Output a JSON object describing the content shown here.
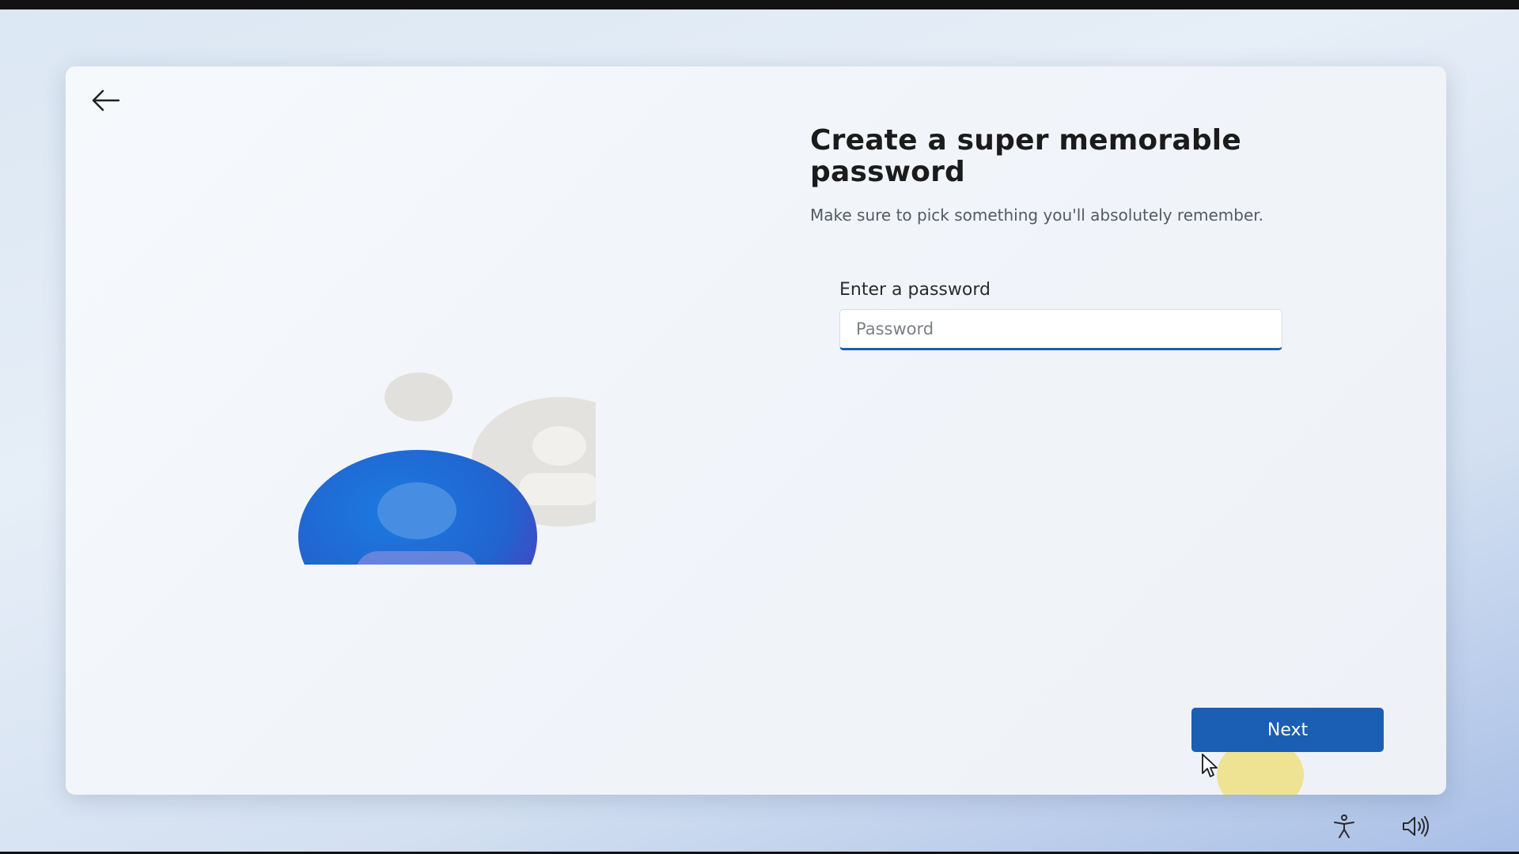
{
  "setup": {
    "heading": "Create a super memorable password",
    "subtext": "Make sure to pick something you'll absolutely remember.",
    "password_label": "Enter a password",
    "password_placeholder": "Password",
    "password_value": "",
    "next_label": "Next"
  },
  "icons": {
    "back": "arrow-left-icon",
    "illustration": "user-accounts-illustration",
    "accessibility": "accessibility-icon",
    "volume": "volume-icon"
  },
  "colors": {
    "accent": "#1a5fb4",
    "avatar_primary": "#1f6fd8",
    "avatar_secondary": "#e3e1dd"
  }
}
